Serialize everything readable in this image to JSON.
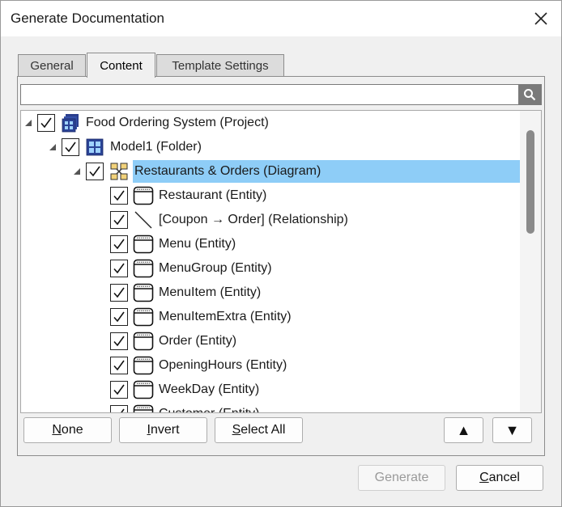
{
  "window": {
    "title": "Generate Documentation"
  },
  "tabs": [
    {
      "label": "General",
      "active": false
    },
    {
      "label": "Content",
      "active": true
    },
    {
      "label": "Template Settings",
      "active": false
    }
  ],
  "search": {
    "value": "",
    "placeholder": ""
  },
  "tree": {
    "rows": [
      {
        "label": "Food Ordering System (Project)",
        "level": 0,
        "expanded": true,
        "checked": true,
        "icon": "project-icon",
        "selected": false
      },
      {
        "label": "Model1 (Folder)",
        "level": 1,
        "expanded": true,
        "checked": true,
        "icon": "folder-model-icon",
        "selected": false
      },
      {
        "label": "Restaurants & Orders (Diagram)",
        "level": 2,
        "expanded": true,
        "checked": true,
        "icon": "diagram-icon",
        "selected": true
      },
      {
        "label": "Restaurant (Entity)",
        "level": 3,
        "checked": true,
        "icon": "entity-icon",
        "selected": false
      },
      {
        "label": "[Coupon → Order] (Relationship)",
        "level": 3,
        "checked": true,
        "icon": "relationship-icon",
        "selected": false
      },
      {
        "label": "Menu (Entity)",
        "level": 3,
        "checked": true,
        "icon": "entity-icon",
        "selected": false
      },
      {
        "label": "MenuGroup (Entity)",
        "level": 3,
        "checked": true,
        "icon": "entity-icon",
        "selected": false
      },
      {
        "label": "MenuItem (Entity)",
        "level": 3,
        "checked": true,
        "icon": "entity-icon",
        "selected": false
      },
      {
        "label": "MenuItemExtra (Entity)",
        "level": 3,
        "checked": true,
        "icon": "entity-icon",
        "selected": false
      },
      {
        "label": "Order (Entity)",
        "level": 3,
        "checked": true,
        "icon": "entity-icon",
        "selected": false
      },
      {
        "label": "OpeningHours (Entity)",
        "level": 3,
        "checked": true,
        "icon": "entity-icon",
        "selected": false
      },
      {
        "label": "WeekDay (Entity)",
        "level": 3,
        "checked": true,
        "icon": "entity-icon",
        "selected": false
      },
      {
        "label": "Customer (Entity)",
        "level": 3,
        "checked": true,
        "icon": "entity-icon",
        "selected": false
      }
    ]
  },
  "selection_buttons": {
    "none": {
      "mnemonic": "N",
      "rest": "one"
    },
    "invert": {
      "mnemonic": "I",
      "rest": "nvert"
    },
    "select_all": {
      "mnemonic": "S",
      "rest": "elect All"
    },
    "move_up_glyph": "▲",
    "move_down_glyph": "▼"
  },
  "dialog_buttons": {
    "generate": {
      "label": "Generate",
      "enabled": false
    },
    "cancel": {
      "mnemonic": "C",
      "rest": "ancel"
    }
  },
  "colors": {
    "selection": "#8ecdf7",
    "scroll_thumb": "#8a8a8a",
    "search_button": "#7a7a7a"
  }
}
